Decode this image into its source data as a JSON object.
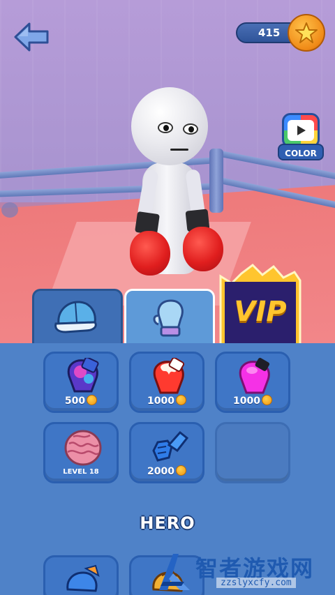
{
  "header": {
    "coin_count": "415",
    "back_icon": "back-arrow-icon"
  },
  "color_button": {
    "label": "COLOR",
    "icon": "palette-play-icon"
  },
  "tabs": [
    {
      "id": "hats",
      "icon": "cap-icon",
      "selected": false
    },
    {
      "id": "gloves",
      "icon": "glove-icon",
      "selected": true
    },
    {
      "id": "vip",
      "label": "VIP",
      "selected": false
    }
  ],
  "shop": {
    "items": [
      {
        "name": "galaxy-glove",
        "price": "500",
        "currency": "coin"
      },
      {
        "name": "flame-glove",
        "price": "1000",
        "currency": "coin"
      },
      {
        "name": "pink-glove",
        "price": "1000",
        "currency": "coin"
      },
      {
        "name": "brain-glove",
        "unlock": "LEVEL 18"
      },
      {
        "name": "armor-glove",
        "price": "2000",
        "currency": "coin"
      },
      {
        "name": "empty-slot"
      }
    ],
    "section_title": "HERO"
  },
  "watermark": {
    "text": "智者游戏网",
    "url": "zzslyxcfy.com"
  },
  "colors": {
    "panel": "#4f82c8",
    "tile": "#3f76c6",
    "glove_red": "#e01e1e",
    "coin": "#f08a17",
    "vip_gold": "#ffc52e"
  }
}
